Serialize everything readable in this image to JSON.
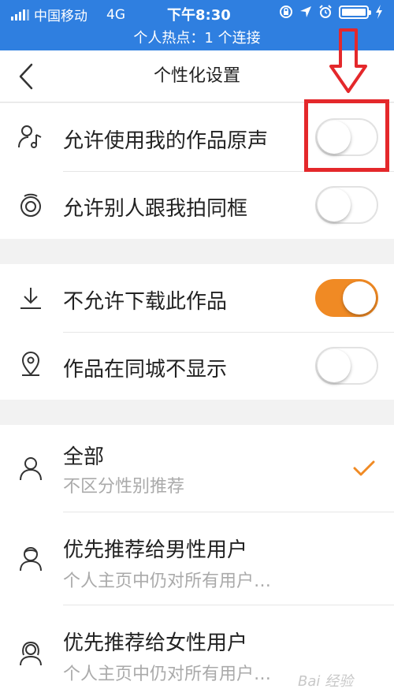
{
  "status_bar": {
    "carrier": "中国移动",
    "network": "4G",
    "time": "下午8:30",
    "hotspot": "个人热点：1 个连接"
  },
  "nav": {
    "title": "个性化设置"
  },
  "group1": {
    "items": [
      {
        "label": "允许使用我的作品原声",
        "icon": "music-note-person-icon",
        "toggle_on": false
      },
      {
        "label": "允许别人跟我拍同框",
        "icon": "duet-icon",
        "toggle_on": false
      }
    ]
  },
  "group2": {
    "items": [
      {
        "label": "不允许下载此作品",
        "icon": "download-icon",
        "toggle_on": true
      },
      {
        "label": "作品在同城不显示",
        "icon": "location-pin-icon",
        "toggle_on": false
      }
    ]
  },
  "group3": {
    "items": [
      {
        "label": "全部",
        "subtitle": "不区分性别推荐",
        "icon": "user-icon",
        "selected": true
      },
      {
        "label": "优先推荐给男性用户",
        "subtitle": "个人主页中仍对所有用户…",
        "icon": "male-user-icon",
        "selected": false
      },
      {
        "label": "优先推荐给女性用户",
        "subtitle": "个人主页中仍对所有用户…",
        "icon": "female-user-icon",
        "selected": false
      }
    ]
  },
  "colors": {
    "status_bar": "#2f7fe0",
    "accent": "#f08a24",
    "annotation": "#e4282b"
  },
  "watermark": "Bai 经验"
}
